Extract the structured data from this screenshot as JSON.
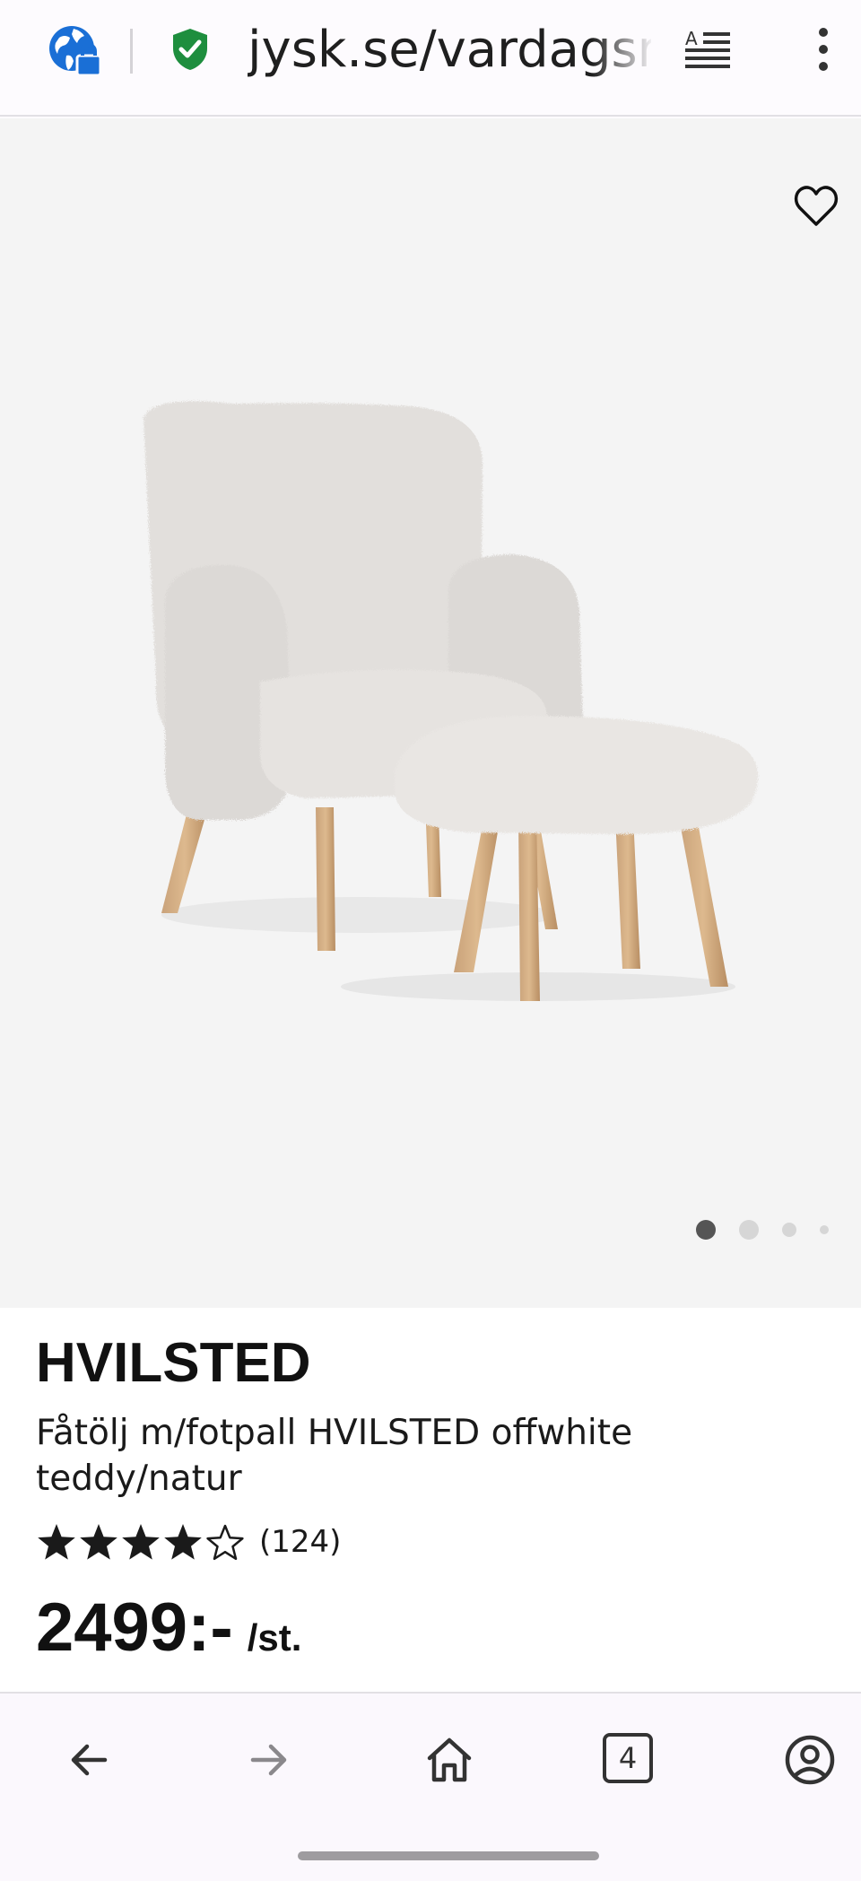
{
  "browser": {
    "url": "jysk.se/vardagsrum",
    "tab_count": "4",
    "icons": {
      "site_info": "globe-lock-icon",
      "security": "shield-check-icon",
      "reader_mode": "reader-mode-icon",
      "menu": "more-vert-icon"
    }
  },
  "gallery": {
    "image": "chair-with-footstool-photo",
    "favorite_icon": "heart-outline-icon",
    "image_count": 4,
    "active_index": 0
  },
  "product": {
    "name": "HVILSTED",
    "description": "Fåtölj m/fotpall HVILSTED offwhite teddy/natur",
    "rating": 4,
    "rating_max": 5,
    "review_count": "(124)",
    "price": "2499:-",
    "price_unit": "/st."
  },
  "bottom_nav": {
    "items": [
      "back-arrow-icon",
      "forward-arrow-icon",
      "home-icon",
      "tabs-counter-icon",
      "account-icon"
    ]
  },
  "colors": {
    "globe_blue": "#1a6fd6",
    "shield_green": "#1e8e3e",
    "star_fill": "#1a1a1a",
    "gallery_bg": "#f4f4f4"
  }
}
